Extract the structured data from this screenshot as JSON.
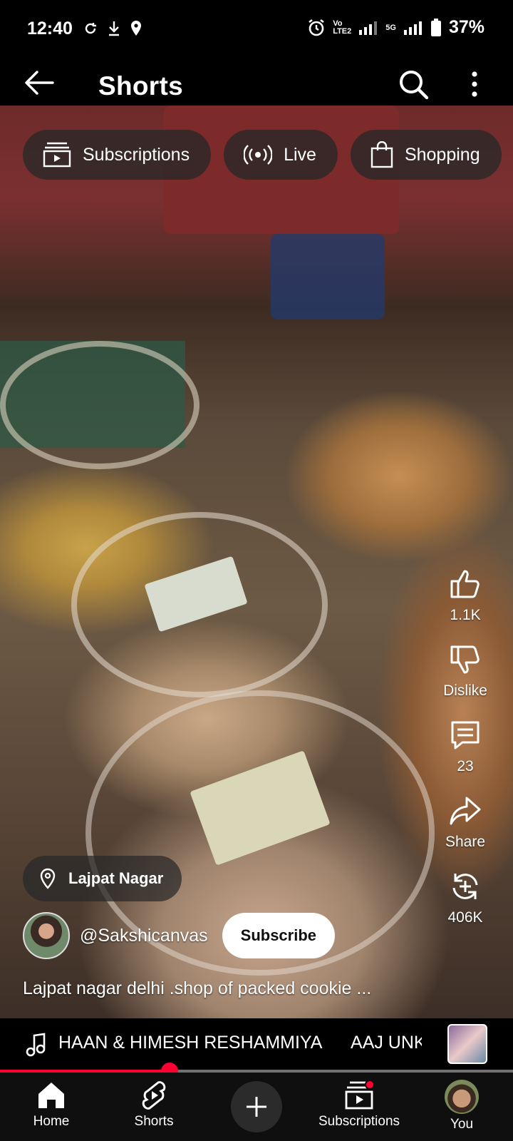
{
  "status_bar": {
    "time": "12:40",
    "volte_top": "Vo",
    "volte_bottom": "LTE2",
    "network": "5G",
    "battery": "37%"
  },
  "header": {
    "title": "Shorts",
    "back_icon": "arrow-left-icon",
    "search_icon": "search-icon",
    "more_icon": "more-vertical-icon"
  },
  "chips": [
    {
      "label": "Subscriptions",
      "icon": "subscriptions-icon"
    },
    {
      "label": "Live",
      "icon": "live-icon"
    },
    {
      "label": "Shopping",
      "icon": "shopping-bag-icon"
    }
  ],
  "actions": {
    "like": "1.1K",
    "dislike": "Dislike",
    "comments": "23",
    "share": "Share",
    "remix": "406K"
  },
  "location": "Lajpat Nagar",
  "channel": {
    "name": "@Sakshicanvas",
    "subscribe_label": "Subscribe"
  },
  "video_title": "Lajpat nagar delhi .shop of packed cookie ...",
  "music": {
    "track": "HAAN & HIMESH RESHAMMIYA",
    "track_next": "AAJ UNKE"
  },
  "progress_percent": 33,
  "nav": {
    "home": "Home",
    "shorts": "Shorts",
    "subscriptions": "Subscriptions",
    "you": "You"
  },
  "colors": {
    "accent": "#ff0033",
    "background": "#000000"
  }
}
